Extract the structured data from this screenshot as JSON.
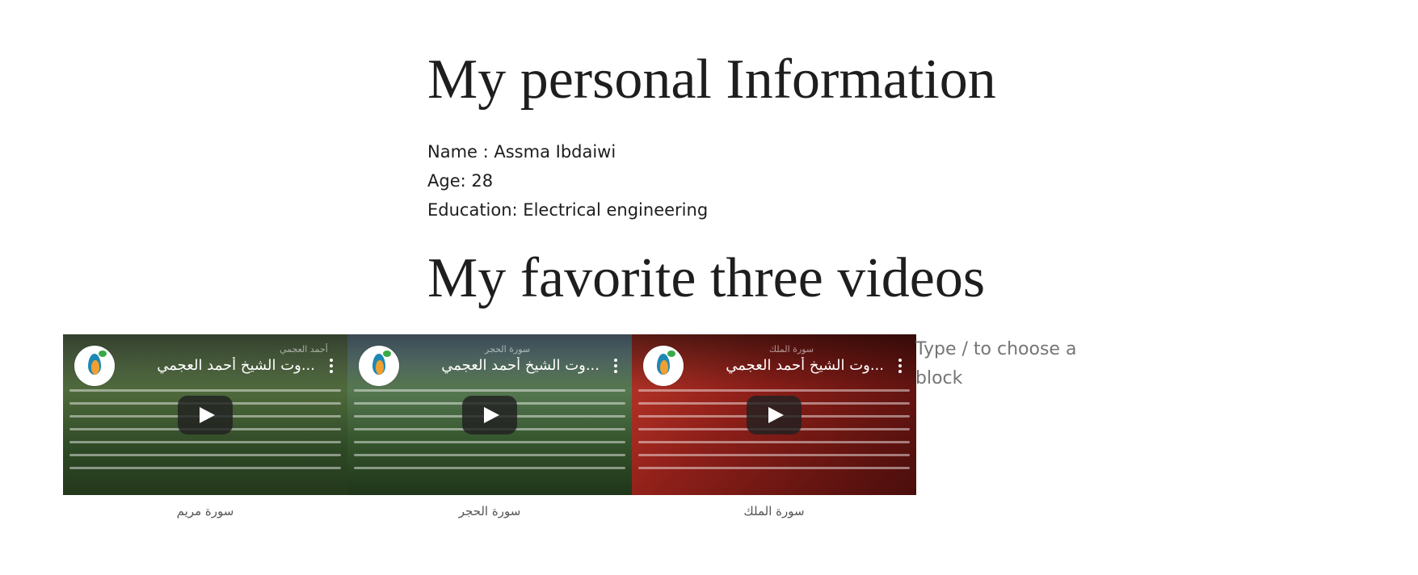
{
  "headings": {
    "personal_info": "My personal Information",
    "videos": "My favorite three videos"
  },
  "info": {
    "name": "Name : Assma Ibdaiwi",
    "age": "Age: 28",
    "education": "Education: Electrical engineering"
  },
  "videos": [
    {
      "title": "...وت الشيخ أحمد العجمي",
      "caption": "سورة مريم",
      "badge": "أحمد العجمي",
      "icon": "play-icon"
    },
    {
      "title": "...وت الشيخ أحمد العجمي",
      "caption": "سورة الحجر",
      "badge": "سورة الحجر",
      "icon": "play-icon"
    },
    {
      "title": "...وت الشيخ أحمد العجمي",
      "caption": "سورة الملك",
      "badge": "سورة الملك",
      "icon": "play-icon"
    }
  ],
  "editor": {
    "block_placeholder": "Type / to choose a block"
  },
  "colors": {
    "text": "#1e1e1e",
    "caption": "#555555",
    "placeholder": "#757575"
  }
}
